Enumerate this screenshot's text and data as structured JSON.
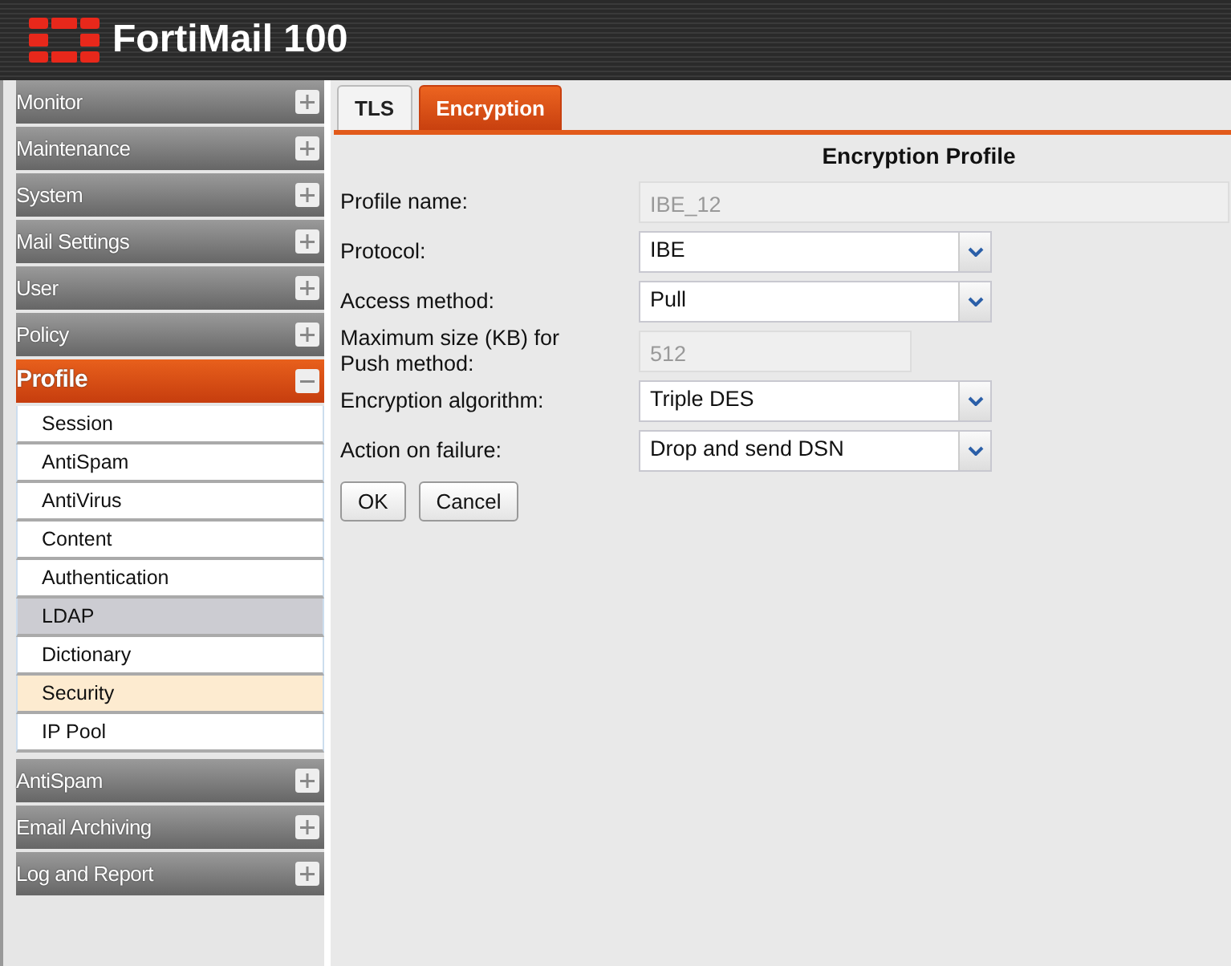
{
  "header": {
    "title": "FortiMail 100"
  },
  "sidebar": {
    "items": [
      {
        "label": "Monitor",
        "expanded": false
      },
      {
        "label": "Maintenance",
        "expanded": false
      },
      {
        "label": "System",
        "expanded": false
      },
      {
        "label": "Mail Settings",
        "expanded": false
      },
      {
        "label": "User",
        "expanded": false
      },
      {
        "label": "Policy",
        "expanded": false
      },
      {
        "label": "Profile",
        "expanded": true,
        "children": [
          {
            "label": "Session",
            "selected": false,
            "hovered": false
          },
          {
            "label": "AntiSpam",
            "selected": false,
            "hovered": false
          },
          {
            "label": "AntiVirus",
            "selected": false,
            "hovered": false
          },
          {
            "label": "Content",
            "selected": false,
            "hovered": false
          },
          {
            "label": "Authentication",
            "selected": false,
            "hovered": false
          },
          {
            "label": "LDAP",
            "selected": false,
            "hovered": true
          },
          {
            "label": "Dictionary",
            "selected": false,
            "hovered": false
          },
          {
            "label": "Security",
            "selected": true,
            "hovered": false
          },
          {
            "label": "IP Pool",
            "selected": false,
            "hovered": false
          }
        ]
      },
      {
        "label": "AntiSpam",
        "expanded": false
      },
      {
        "label": "Email Archiving",
        "expanded": false
      },
      {
        "label": "Log and Report",
        "expanded": false
      }
    ]
  },
  "tabs": [
    {
      "label": "TLS",
      "selected": false
    },
    {
      "label": "Encryption",
      "selected": true
    }
  ],
  "form": {
    "title": "Encryption Profile",
    "fields": [
      {
        "label": "Profile name:",
        "kind": "text",
        "value": "IBE_12",
        "disabled": true
      },
      {
        "label": "Protocol:",
        "kind": "select",
        "value": "IBE"
      },
      {
        "label": "Access method:",
        "kind": "select",
        "value": "Pull"
      },
      {
        "label": "Maximum size (KB) for Push method:",
        "kind": "number",
        "value": "512",
        "disabled": true
      },
      {
        "label": "Encryption algorithm:",
        "kind": "select",
        "value": "Triple DES"
      },
      {
        "label": "Action on failure:",
        "kind": "select",
        "value": "Drop and send DSN"
      }
    ],
    "buttons": [
      "OK",
      "Cancel"
    ]
  }
}
